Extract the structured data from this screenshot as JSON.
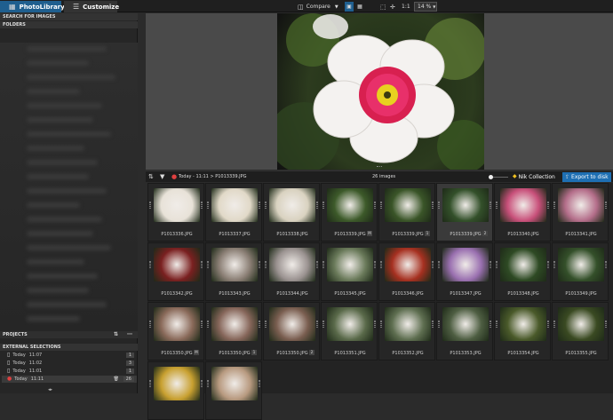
{
  "top": {
    "tab_photolibrary": "PhotoLibrary",
    "tab_customize": "Customize",
    "compare_label": "Compare",
    "zoom_ratio": "1:1",
    "zoom_percent": "14 %"
  },
  "sidebar": {
    "search": "SEARCH FOR IMAGES",
    "folders": "FOLDERS",
    "projects": "PROJECTS",
    "external": "EXTERNAL SELECTIONS",
    "ext_rows": [
      {
        "label": "Today",
        "time": "11:07",
        "count": "1"
      },
      {
        "label": "Today",
        "time": "11:02",
        "count": "3"
      },
      {
        "label": "Today",
        "time": "11:01",
        "count": "1"
      },
      {
        "label": "Today",
        "time": "11:11",
        "count": "26"
      }
    ]
  },
  "strip": {
    "breadcrumb": "Today - 11:11  >  P1013339.JPG",
    "image_count": "26 images",
    "nik_label": "Nik Collection",
    "export_label": "Export to disk"
  },
  "thumbs": [
    {
      "name": "P1013336.JPG",
      "bg": "#e8e2d8",
      "badge": ""
    },
    {
      "name": "P1013337.JPG",
      "bg": "#e1d9c8",
      "badge": ""
    },
    {
      "name": "P1013338.JPG",
      "bg": "#d9d2c0",
      "badge": ""
    },
    {
      "name": "P1013339.JPG",
      "bg": "#3d5a2a",
      "badge": "M"
    },
    {
      "name": "P1013339.JPG",
      "bg": "#3a5528",
      "badge": "1"
    },
    {
      "name": "P1013339.JPG",
      "bg": "#33502a",
      "badge": "2"
    },
    {
      "name": "P1013340.JPG",
      "bg": "#c8507a",
      "badge": ""
    },
    {
      "name": "P1013341.JPG",
      "bg": "#b46e8a",
      "badge": ""
    },
    {
      "name": "P1013342.JPG",
      "bg": "#7a2020",
      "badge": ""
    },
    {
      "name": "P1013343.JPG",
      "bg": "#8a7e74",
      "badge": ""
    },
    {
      "name": "P1013344.JPG",
      "bg": "#9a9290",
      "badge": ""
    },
    {
      "name": "P1013345.JPG",
      "bg": "#6a7a5a",
      "badge": ""
    },
    {
      "name": "P1013346.JPG",
      "bg": "#a63020",
      "badge": ""
    },
    {
      "name": "P1013347.JPG",
      "bg": "#9a70b0",
      "badge": ""
    },
    {
      "name": "P1013348.JPG",
      "bg": "#2e4a24",
      "badge": ""
    },
    {
      "name": "P1013349.JPG",
      "bg": "#34502a",
      "badge": ""
    },
    {
      "name": "P1013350.JPG",
      "bg": "#8a6a5a",
      "badge": "M"
    },
    {
      "name": "P1013350.JPG",
      "bg": "#86665a",
      "badge": "1"
    },
    {
      "name": "P1013350.JPG",
      "bg": "#7a5e50",
      "badge": "2"
    },
    {
      "name": "P1013351.JPG",
      "bg": "#5a6a4a",
      "badge": ""
    },
    {
      "name": "P1013352.JPG",
      "bg": "#5e6e50",
      "badge": ""
    },
    {
      "name": "P1013353.JPG",
      "bg": "#4e5e42",
      "badge": ""
    },
    {
      "name": "P1013354.JPG",
      "bg": "#4a5a2a",
      "badge": ""
    },
    {
      "name": "P1013355.JPG",
      "bg": "#3a4a22",
      "badge": ""
    },
    {
      "name": "",
      "bg": "#c8a030",
      "badge": ""
    },
    {
      "name": "",
      "bg": "#b89a80",
      "badge": ""
    }
  ],
  "colors": {
    "accent": "#1f5f8f",
    "export": "#1e6fb3"
  }
}
